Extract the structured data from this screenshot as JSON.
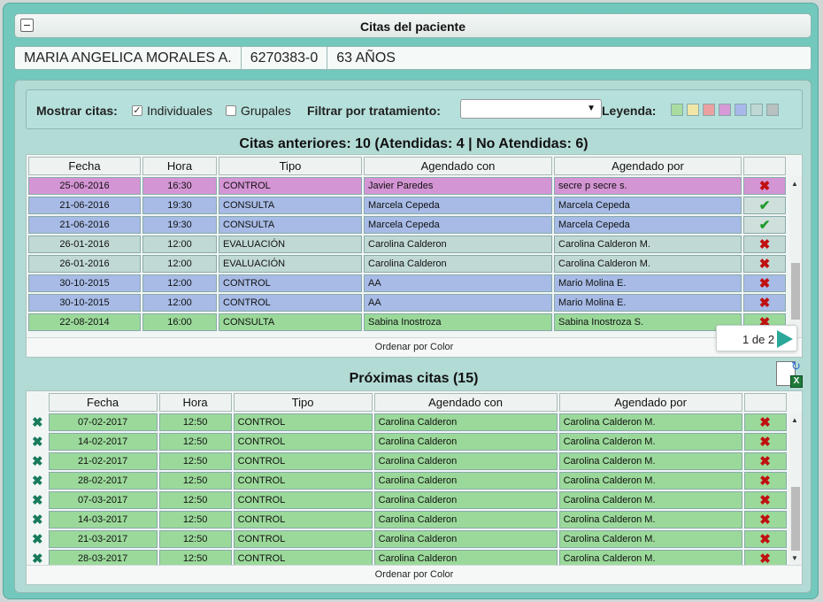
{
  "window": {
    "title": "Citas del paciente"
  },
  "patient": {
    "name": "MARIA ANGELICA MORALES A.",
    "id": "6270383-0",
    "age": "63 AÑOS"
  },
  "filters": {
    "show_label": "Mostrar citas:",
    "individual_label": "Individuales",
    "individual_checked": true,
    "group_label": "Grupales",
    "group_checked": false,
    "treatment_label": "Filtrar por tratamiento:",
    "treatment_value": "",
    "legend_label": "Leyenda:",
    "legend_colors": [
      "#a8dca0",
      "#f0e6a8",
      "#eaa0a0",
      "#d69ad6",
      "#a8b8ea",
      "#c0d8d4",
      "#b8c0c0"
    ]
  },
  "past": {
    "title": "Citas anteriores: 10 (Atendidas: 4 | No Atendidas: 6)",
    "headers": [
      "Fecha",
      "Hora",
      "Tipo",
      "Agendado con",
      "Agendado por",
      ""
    ],
    "rows": [
      {
        "fecha": "25-06-2016",
        "hora": "16:30",
        "tipo": "CONTROL",
        "con": "Javier Paredes",
        "por": "secre p secre s.",
        "status": "x",
        "color": "#d495d4"
      },
      {
        "fecha": "21-06-2016",
        "hora": "19:30",
        "tipo": "CONSULTA",
        "con": "Marcela Cepeda",
        "por": "Marcela Cepeda",
        "status": "ok",
        "color": "#a7bbe6"
      },
      {
        "fecha": "21-06-2016",
        "hora": "19:30",
        "tipo": "CONSULTA",
        "con": "Marcela Cepeda",
        "por": "Marcela Cepeda",
        "status": "ok",
        "color": "#a7bbe6"
      },
      {
        "fecha": "26-01-2016",
        "hora": "12:00",
        "tipo": "EVALUACIÓN",
        "con": "Carolina Calderon",
        "por": "Carolina Calderon M.",
        "status": "x",
        "color": "#c1d9d5"
      },
      {
        "fecha": "26-01-2016",
        "hora": "12:00",
        "tipo": "EVALUACIÓN",
        "con": "Carolina Calderon",
        "por": "Carolina Calderon M.",
        "status": "x",
        "color": "#c1d9d5"
      },
      {
        "fecha": "30-10-2015",
        "hora": "12:00",
        "tipo": "CONTROL",
        "con": "AA",
        "por": "Mario Molina E.",
        "status": "x",
        "color": "#a7bbe6"
      },
      {
        "fecha": "30-10-2015",
        "hora": "12:00",
        "tipo": "CONTROL",
        "con": "AA",
        "por": "Mario Molina E.",
        "status": "x",
        "color": "#a7bbe6"
      },
      {
        "fecha": "22-08-2014",
        "hora": "16:00",
        "tipo": "CONSULTA",
        "con": "Sabina Inostroza",
        "por": "Sabina Inostroza S.",
        "status": "x",
        "color": "#9bd99a"
      }
    ],
    "sort_label": "Ordenar por Color",
    "pager": "1 de 2"
  },
  "upcoming": {
    "title": "Próximas citas (15)",
    "headers": [
      "Fecha",
      "Hora",
      "Tipo",
      "Agendado con",
      "Agendado por",
      ""
    ],
    "rows": [
      {
        "fecha": "07-02-2017",
        "hora": "12:50",
        "tipo": "CONTROL",
        "con": "Carolina Calderon",
        "por": "Carolina Calderon M."
      },
      {
        "fecha": "14-02-2017",
        "hora": "12:50",
        "tipo": "CONTROL",
        "con": "Carolina Calderon",
        "por": "Carolina Calderon M."
      },
      {
        "fecha": "21-02-2017",
        "hora": "12:50",
        "tipo": "CONTROL",
        "con": "Carolina Calderon",
        "por": "Carolina Calderon M."
      },
      {
        "fecha": "28-02-2017",
        "hora": "12:50",
        "tipo": "CONTROL",
        "con": "Carolina Calderon",
        "por": "Carolina Calderon M."
      },
      {
        "fecha": "07-03-2017",
        "hora": "12:50",
        "tipo": "CONTROL",
        "con": "Carolina Calderon",
        "por": "Carolina Calderon M."
      },
      {
        "fecha": "14-03-2017",
        "hora": "12:50",
        "tipo": "CONTROL",
        "con": "Carolina Calderon",
        "por": "Carolina Calderon M."
      },
      {
        "fecha": "21-03-2017",
        "hora": "12:50",
        "tipo": "CONTROL",
        "con": "Carolina Calderon",
        "por": "Carolina Calderon M."
      },
      {
        "fecha": "28-03-2017",
        "hora": "12:50",
        "tipo": "CONTROL",
        "con": "Carolina Calderon",
        "por": "Carolina Calderon M."
      }
    ],
    "row_color": "#9bd99a",
    "sort_label": "Ordenar por Color"
  }
}
